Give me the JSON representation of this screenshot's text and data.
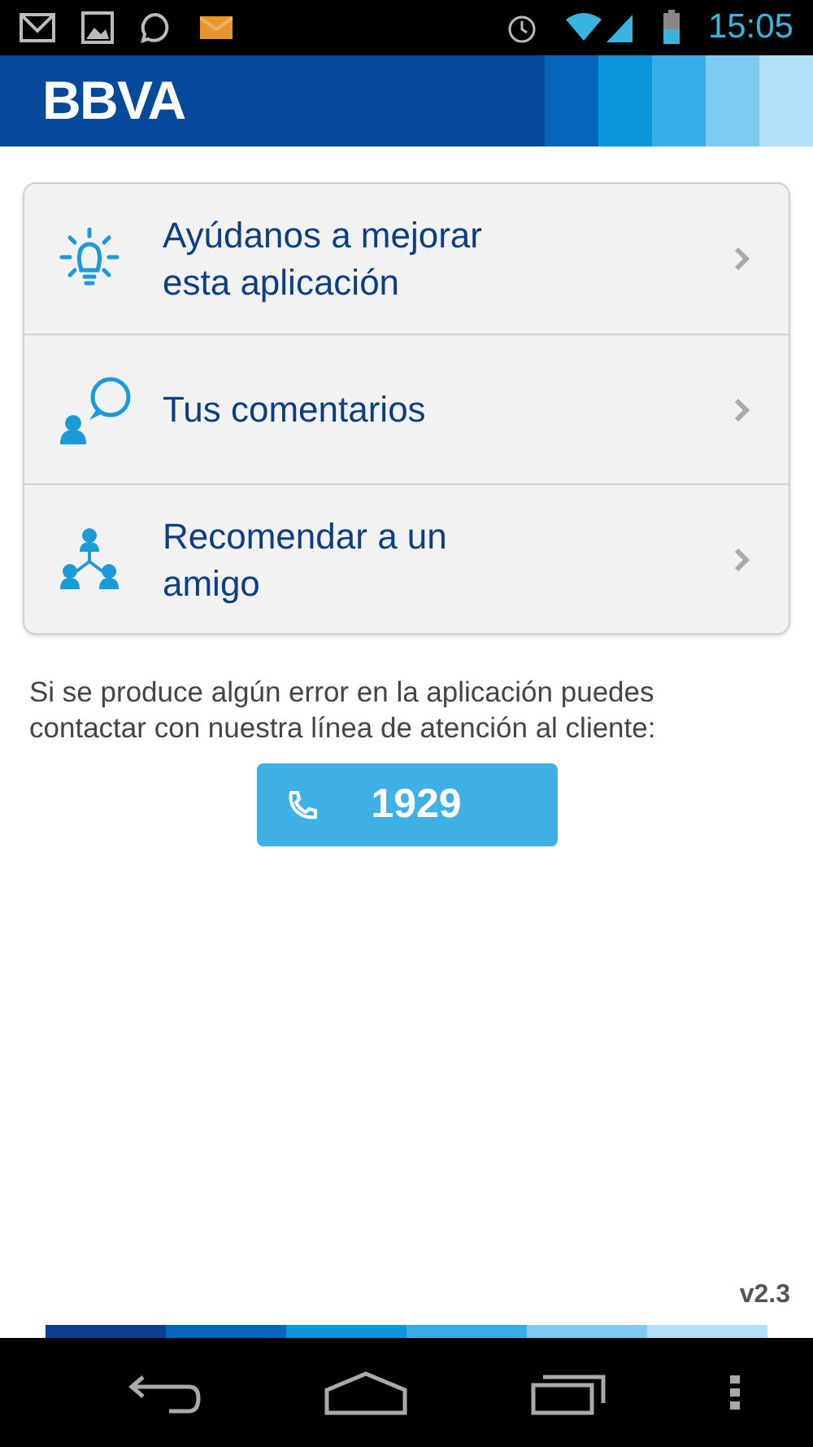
{
  "status_bar": {
    "time": "15:05"
  },
  "header": {
    "logo": "BBVA"
  },
  "menu": [
    {
      "kind": "idea",
      "label": "Ayúdanos a mejorar esta aplicación"
    },
    {
      "kind": "comments",
      "label": "Tus comentarios"
    },
    {
      "kind": "share",
      "label": "Recomendar a un amigo"
    }
  ],
  "help_text": "Si se produce algún error en la aplicación puedes contactar con nuestra línea de atención al cliente:",
  "phone_button": {
    "label": "1929"
  },
  "version": "v2.3"
}
